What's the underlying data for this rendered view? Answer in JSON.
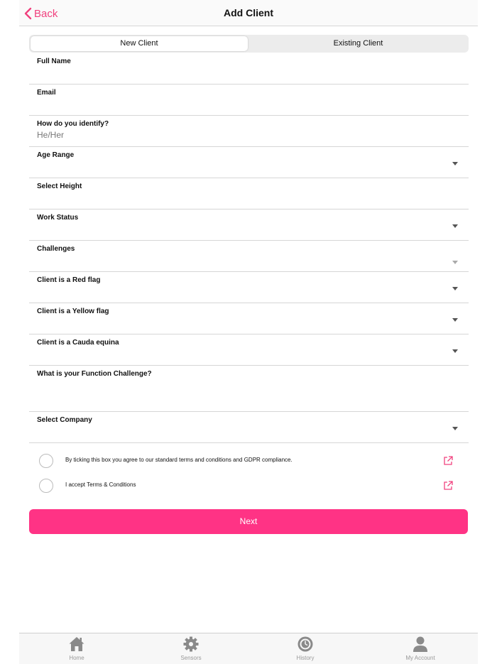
{
  "header": {
    "back_label": "Back",
    "title": "Add Client"
  },
  "segments": {
    "new_client": "New Client",
    "existing_client": "Existing Client",
    "selected": "New Client"
  },
  "form": {
    "full_name": {
      "label": "Full Name",
      "value": ""
    },
    "email": {
      "label": "Email",
      "value": ""
    },
    "identify": {
      "label": "How do you identify?",
      "value": "He/Her"
    },
    "age_range": {
      "label": "Age Range"
    },
    "height": {
      "label": "Select Height"
    },
    "work_status": {
      "label": "Work Status"
    },
    "challenges": {
      "label": "Challenges"
    },
    "red_flag": {
      "label": "Client is a Red flag"
    },
    "yellow_flag": {
      "label": "Client is a Yellow flag"
    },
    "cauda_equina": {
      "label": "Client is a Cauda equina"
    },
    "function_challenge": {
      "label": "What is your Function Challenge?",
      "value": ""
    },
    "company": {
      "label": "Select Company"
    }
  },
  "agreements": {
    "gdpr": "By ticking this box you agree to our standard terms and conditions and GDPR compliance.",
    "terms": "I accept Terms & Conditions"
  },
  "next_label": "Next",
  "tabs": {
    "home": "Home",
    "sensors": "Sensors",
    "history": "History",
    "account": "My Account"
  },
  "colors": {
    "accent": "#ff3385",
    "back_link": "#f0417e",
    "tab_icon": "#8a8a8a"
  }
}
